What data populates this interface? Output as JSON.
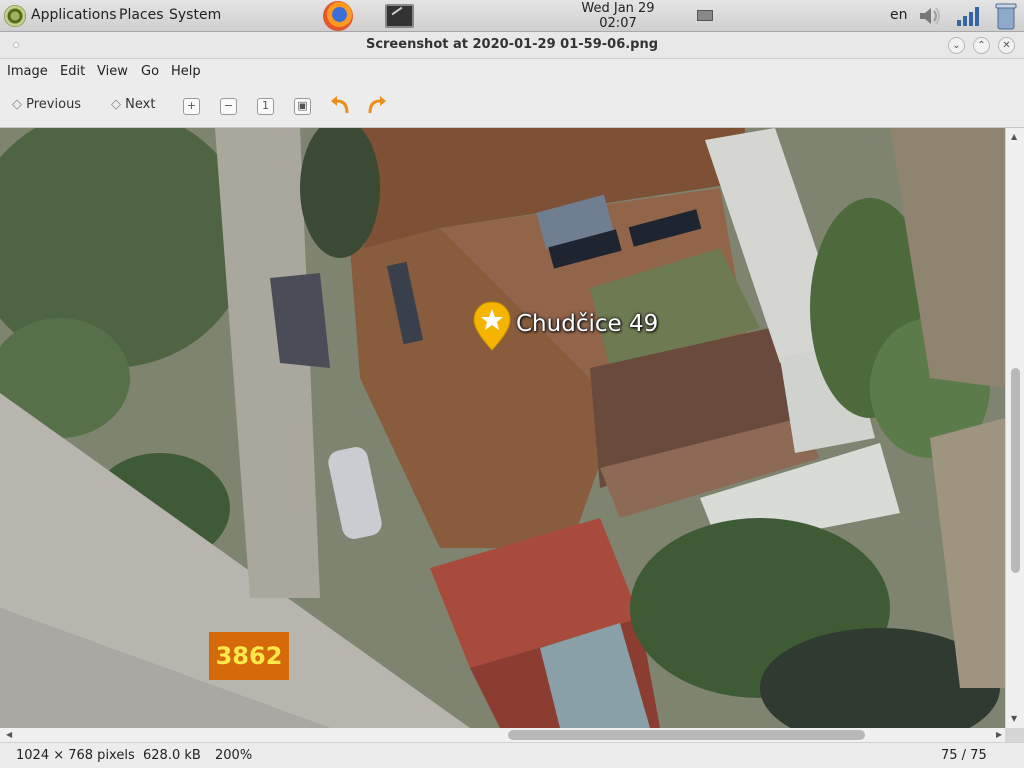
{
  "panel": {
    "menus": [
      "Applications",
      "Places",
      "System"
    ],
    "clock_line1": "Wed Jan 29",
    "clock_line2": "02:07",
    "language": "en",
    "icons": [
      "distro-logo-icon",
      "firefox-icon",
      "terminal-icon",
      "battery-icon",
      "volume-icon",
      "network-signal-icon",
      "trash-icon"
    ]
  },
  "window": {
    "title": "Screenshot at 2020-01-29 01-59-06.png",
    "controls": [
      "minimize-icon",
      "maximize-icon",
      "close-icon"
    ]
  },
  "menubar": [
    "Image",
    "Edit",
    "View",
    "Go",
    "Help"
  ],
  "toolbar": {
    "previous_label": "Previous",
    "next_label": "Next",
    "icons": [
      "zoom-in-icon",
      "zoom-out-icon",
      "normal-size-icon",
      "best-fit-icon",
      "rotate-left-icon",
      "rotate-right-icon"
    ]
  },
  "image": {
    "place_label": "Chudčice 49",
    "road_badge": "3862",
    "pin_icon": "star-pin-icon",
    "badge_color": "#d66a0a",
    "pin_color": "#f5b400"
  },
  "status": {
    "dimensions": "1024 × 768 pixels",
    "size": "628.0 kB",
    "zoom": "200%",
    "position": "75 / 75"
  }
}
